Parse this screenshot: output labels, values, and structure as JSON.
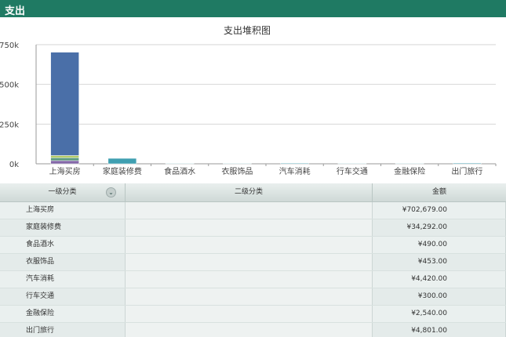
{
  "header": {
    "title": "支出"
  },
  "chart_data": {
    "type": "bar",
    "stacked": true,
    "title": "支出堆积图",
    "categories": [
      "上海买房",
      "家庭装修费",
      "食品酒水",
      "衣服饰品",
      "汽车消耗",
      "行车交通",
      "金融保险",
      "出门旅行"
    ],
    "y_ticks": [
      "0k",
      "250k",
      "500k",
      "750k"
    ],
    "ylim": [
      0,
      750000
    ],
    "grid": true,
    "series": [
      {
        "color": "#8468a8",
        "values": [
          20000,
          0,
          0,
          0,
          0,
          0,
          0,
          0
        ]
      },
      {
        "color": "#5a9a7c",
        "values": [
          18000,
          0,
          0,
          0,
          0,
          0,
          0,
          0
        ]
      },
      {
        "color": "#b4cc66",
        "values": [
          14000,
          0,
          0,
          0,
          0,
          0,
          0,
          0
        ]
      },
      {
        "color": "#3f9fb1",
        "values": [
          0,
          34292,
          490,
          453,
          4420,
          300,
          2540,
          4801
        ]
      },
      {
        "color": "#4a6fa8",
        "values": [
          650679,
          0,
          0,
          0,
          0,
          0,
          0,
          0
        ]
      }
    ]
  },
  "table": {
    "headers": {
      "level1": "一级分类",
      "level2": "二级分类",
      "amount": "金额"
    },
    "rows": [
      {
        "level1": "上海买房",
        "level2": "",
        "amount": "¥702,679.00"
      },
      {
        "level1": "家庭装修费",
        "level2": "",
        "amount": "¥34,292.00"
      },
      {
        "level1": "食品酒水",
        "level2": "",
        "amount": "¥490.00"
      },
      {
        "level1": "衣服饰品",
        "level2": "",
        "amount": "¥453.00"
      },
      {
        "level1": "汽车消耗",
        "level2": "",
        "amount": "¥4,420.00"
      },
      {
        "level1": "行车交通",
        "level2": "",
        "amount": "¥300.00"
      },
      {
        "level1": "金融保险",
        "level2": "",
        "amount": "¥2,540.00"
      },
      {
        "level1": "出门旅行",
        "level2": "",
        "amount": "¥4,801.00"
      }
    ]
  },
  "icons": {
    "sort": "double-chevron-down-icon"
  }
}
